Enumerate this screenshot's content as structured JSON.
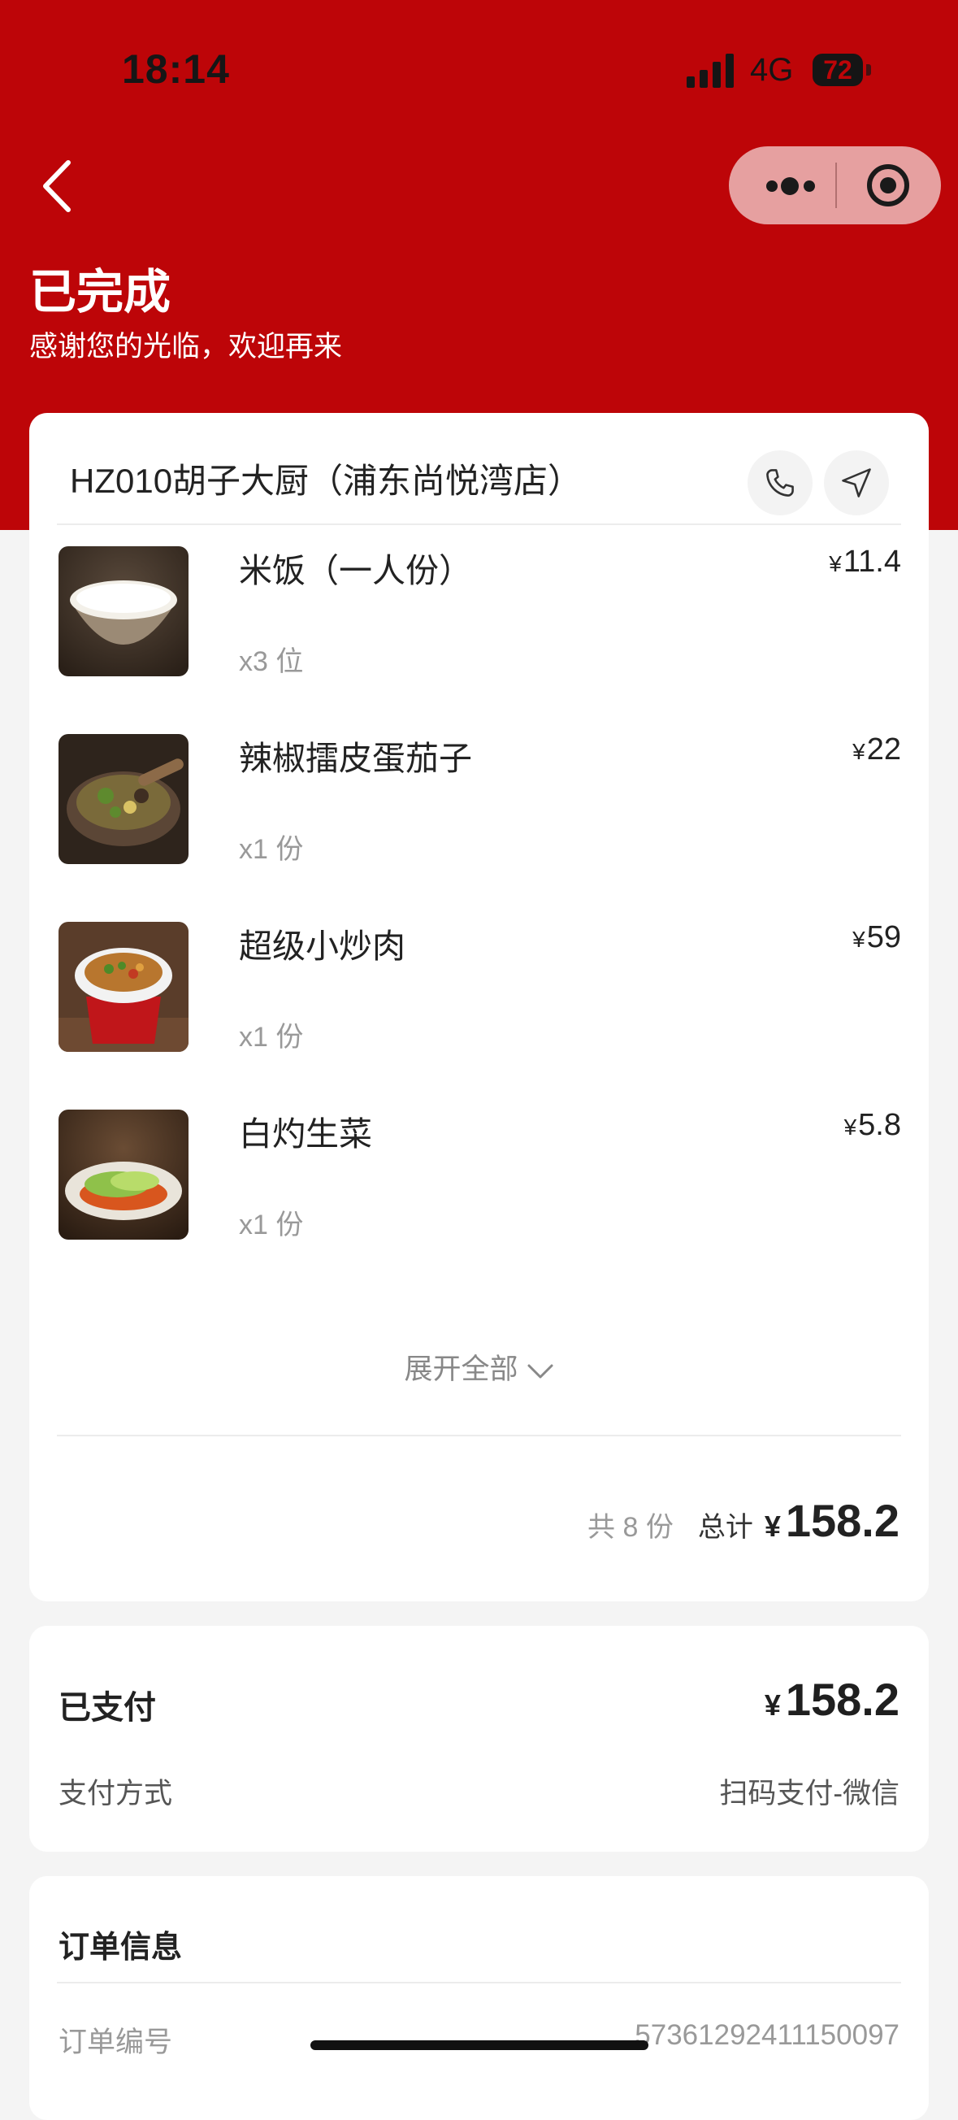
{
  "status_bar": {
    "time": "18:14",
    "network": "4G",
    "battery": "72"
  },
  "header": {
    "title": "已完成",
    "subtitle": "感谢您的光临，欢迎再来"
  },
  "store": {
    "name": "HZ010胡子大厨（浦东尚悦湾店）"
  },
  "currency_symbol": "¥",
  "items": [
    {
      "name": "米饭（一人份）",
      "qty": "x3 位",
      "price": "11.4",
      "image": "rice-bowl"
    },
    {
      "name": "辣椒擂皮蛋茄子",
      "qty": "x1 份",
      "price": "22",
      "image": "pepper-eggplant-dish"
    },
    {
      "name": "超级小炒肉",
      "qty": "x1 份",
      "price": "59",
      "image": "stir-fried-pork-dish"
    },
    {
      "name": "白灼生菜",
      "qty": "x1 份",
      "price": "5.8",
      "image": "boiled-lettuce-dish"
    }
  ],
  "expand_label": "展开全部",
  "summary": {
    "count": "共 8 份",
    "total_label": "总计",
    "total": "158.2"
  },
  "payment": {
    "paid_label": "已支付",
    "paid_amount": "158.2",
    "method_label": "支付方式",
    "method_value": "扫码支付-微信"
  },
  "order_info": {
    "title": "订单信息",
    "number_label": "订单编号",
    "number_value": "57361292411150097"
  },
  "colors": {
    "brand_red": "#bd0508",
    "capsule": "#e6a0a0",
    "page_bg": "#f4f4f4"
  }
}
